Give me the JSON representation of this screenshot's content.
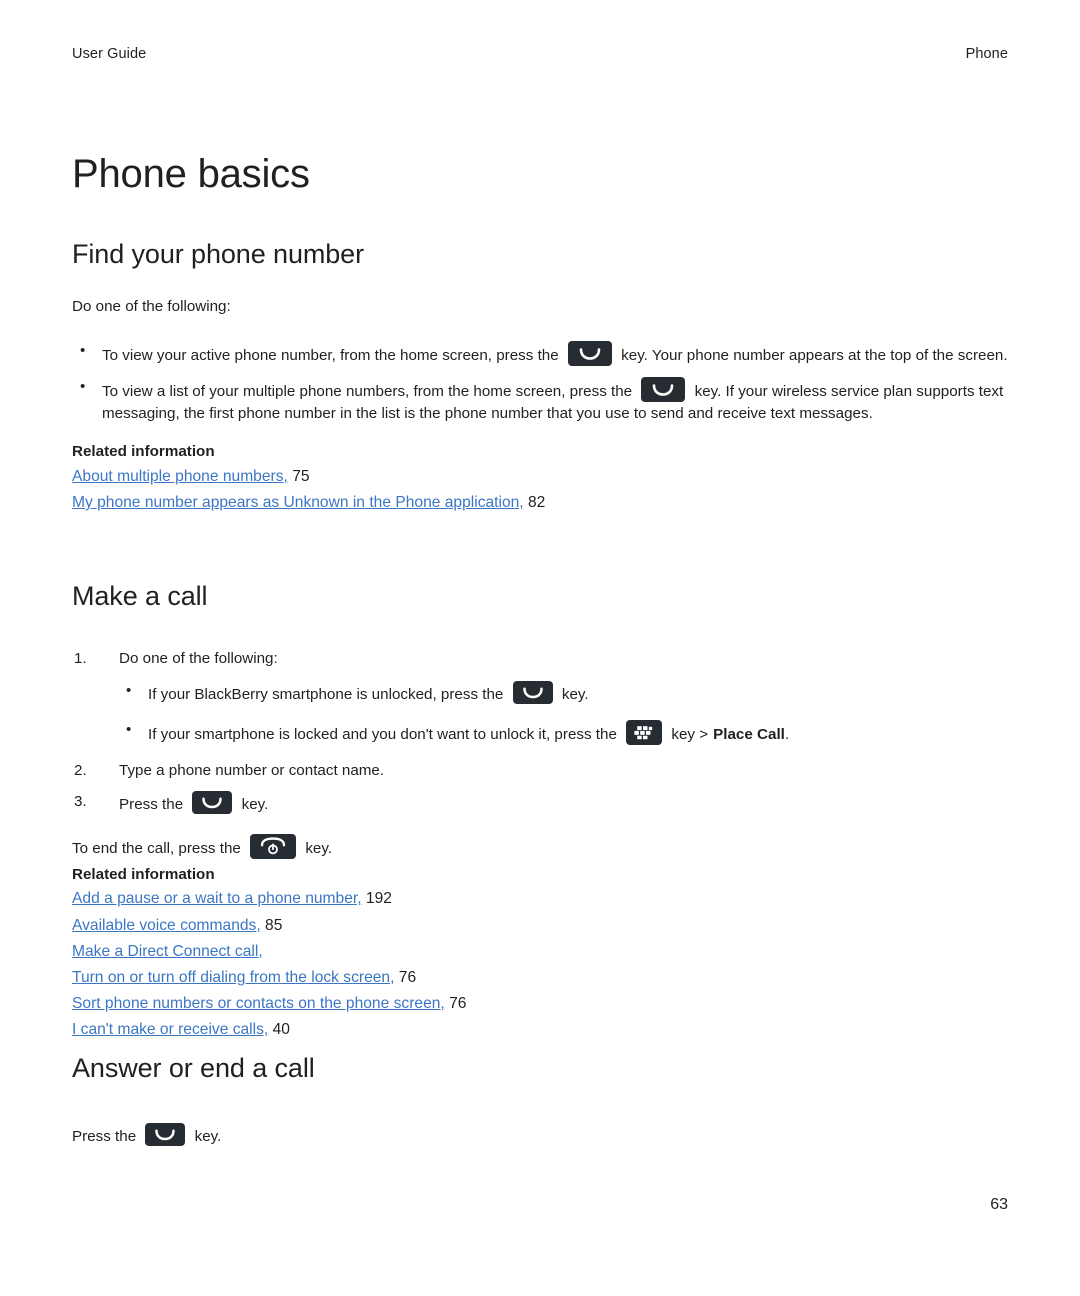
{
  "header": {
    "left": "User Guide",
    "right": "Phone"
  },
  "chapter_title": "Phone basics",
  "colors": {
    "link": "#3b76c4",
    "text": "#231f20",
    "key_icon_bg": "#262c31",
    "key_icon_fg": "#ffffff"
  },
  "sections": [
    {
      "id": "find-your-phone-number",
      "title": "Find your phone number",
      "intro": "Do one of the following:",
      "bullets": [
        {
          "before_icon": "To view your active phone number, from the home screen, press the",
          "icon": "send-key-icon",
          "after_icon": "key. Your phone number appears at the top of the screen."
        },
        {
          "before_icon": "To view a list of your multiple phone numbers, from the home screen, press the",
          "icon": "send-key-icon",
          "after_icon": "key. If your wireless service plan supports text messaging, the first phone number in the list is the phone number that you use to send and receive text messages."
        }
      ],
      "related_heading": "Related information",
      "related_links": [
        {
          "text": "About multiple phone numbers,",
          "page": "75"
        },
        {
          "text": "My phone number appears as Unknown in the Phone application,",
          "page": "82"
        }
      ]
    },
    {
      "id": "make-a-call",
      "title": "Make a call",
      "steps": [
        {
          "num": "1.",
          "text": "Do one of the following:"
        },
        {
          "num": "2.",
          "text": "Type a phone number or contact name."
        },
        {
          "num": "3.",
          "before_icon": "Press the",
          "icon": "send-key-icon",
          "after_icon": "key."
        }
      ],
      "sub_bullets": [
        {
          "before_icon": "If your BlackBerry smartphone is unlocked, press the",
          "icon": "send-key-icon",
          "after_icon": "key."
        },
        {
          "before_icon": "If your smartphone is locked and you don't want to unlock it, press the",
          "icon": "blackberry-menu-key-icon",
          "after_icon": "key >",
          "bold_tail": "Place Call",
          "tail_period": "."
        }
      ],
      "end_call": {
        "before_icon": "To end the call, press the",
        "icon": "end-call-key-icon",
        "after_icon": "key."
      },
      "related_heading": "Related information",
      "related_links": [
        {
          "text": "Add a pause or a wait to a phone number,",
          "page": "192"
        },
        {
          "text": "Available voice commands,",
          "page": "85"
        },
        {
          "text": "Make a Direct Connect call,",
          "page": ""
        },
        {
          "text": "Turn on or turn off dialing from the lock screen,",
          "page": "76"
        },
        {
          "text": "Sort phone numbers or contacts on the phone screen,",
          "page": "76"
        },
        {
          "text": "I can't make or receive calls,",
          "page": "40"
        }
      ]
    },
    {
      "id": "answer-or-end-a-call",
      "title": "Answer or end a call",
      "press": {
        "before_icon": "Press the",
        "icon": "send-key-icon",
        "after_icon": "key."
      }
    }
  ],
  "folio": "63"
}
